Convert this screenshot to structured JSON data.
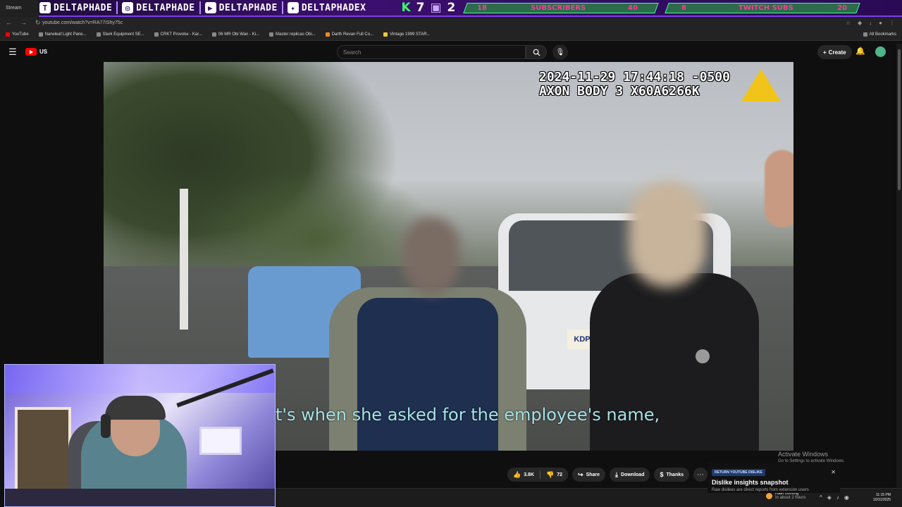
{
  "overlay": {
    "socials": [
      {
        "icon": "twitch-icon",
        "name": "DELTAPHADE"
      },
      {
        "icon": "instagram-icon",
        "name": "DELTAPHADE"
      },
      {
        "icon": "youtube-icon",
        "name": "DELTAPHADE"
      },
      {
        "icon": "twitter-icon",
        "name": "DELTAPHADEX"
      }
    ],
    "kick_count": "7",
    "twitch_count": "2",
    "subscribers_current": "18",
    "subscribers_label": "SUBSCRIBERS",
    "subscribers_goal": "40",
    "twitch_subs_current": "8",
    "twitch_subs_label": "TWITCH SUBS",
    "twitch_subs_goal": "20"
  },
  "browser": {
    "tab_label": "Stream",
    "url": "youtube.com/watch?v=RA77iShy75c",
    "bookmarks": [
      "YouTube",
      "Narwleaf Light Pane...",
      "Stark Equipment SE...",
      "CRKT Provoke - Kar...",
      "06 MR Obi Wan - Ki...",
      "Master replicas Obi...",
      "Darth Revan Full Co...",
      "Vintage 1999 STAR..."
    ],
    "all_bookmarks": "All Bookmarks"
  },
  "youtube": {
    "country": "US",
    "search_placeholder": "Search",
    "create_label": "Create",
    "video": {
      "timestamp": "2024-11-29 17:44:18 -0500",
      "device": "AXON BODY 3 X60A6266K",
      "plate": "KDP",
      "subtitle": "t's when she asked for the employee's name,"
    },
    "actions": {
      "likes": "3.8K",
      "dislikes": "72",
      "share": "Share",
      "download": "Download",
      "thanks": "Thanks"
    },
    "dislike_popup": {
      "tag": "RETURN YOUTUBE DISLIKE",
      "title": "Dislike insights snapshot",
      "desc": "Raw dislikes are direct reports from extension users"
    }
  },
  "windows": {
    "activate_title": "Activate Windows",
    "activate_desc": "Go to Settings to activate Windows.",
    "weather_title": "Rain coming",
    "weather_desc": "In about 2 hours",
    "time": "11:15 PM",
    "date": "10/31/2025"
  }
}
